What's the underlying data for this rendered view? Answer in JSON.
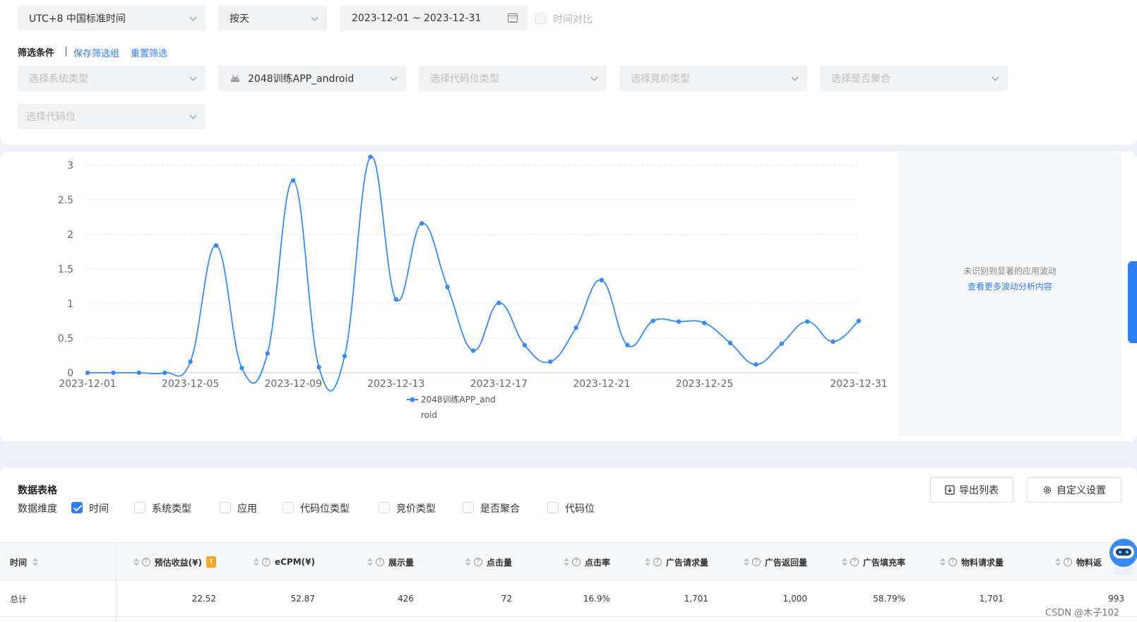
{
  "filters": {
    "timezone": "UTC+8 中国标准时间",
    "granularity": "按天",
    "date_range": "2023-12-01 ~ 2023-12-31",
    "compare_label": "时间对比",
    "conditions_label": "筛选条件",
    "save_group": "保存筛选组",
    "reset": "重置筛选",
    "system_type_placeholder": "选择系统类型",
    "app_selected": "2048训练APP_android",
    "slot_type_placeholder": "选择代码位类型",
    "bid_type_placeholder": "选择竞价类型",
    "aggregate_placeholder": "选择是否聚合",
    "slot_placeholder": "选择代码位"
  },
  "side_panel": {
    "message": "未识别到显著的应用波动",
    "link": "查看更多波动分析内容"
  },
  "chart_data": {
    "type": "line",
    "x": [
      "2023-12-01",
      "2023-12-02",
      "2023-12-03",
      "2023-12-04",
      "2023-12-05",
      "2023-12-06",
      "2023-12-07",
      "2023-12-08",
      "2023-12-09",
      "2023-12-10",
      "2023-12-11",
      "2023-12-12",
      "2023-12-13",
      "2023-12-14",
      "2023-12-15",
      "2023-12-16",
      "2023-12-17",
      "2023-12-18",
      "2023-12-19",
      "2023-12-20",
      "2023-12-21",
      "2023-12-22",
      "2023-12-23",
      "2023-12-24",
      "2023-12-25",
      "2023-12-26",
      "2023-12-27",
      "2023-12-28",
      "2023-12-29",
      "2023-12-30",
      "2023-12-31"
    ],
    "x_tick_labels": [
      "2023-12-01",
      "2023-12-05",
      "2023-12-09",
      "2023-12-13",
      "2023-12-17",
      "2023-12-21",
      "2023-12-25",
      "2023-12-31"
    ],
    "series": [
      {
        "name": "2048训练APP_android",
        "legend_lines": [
          "2048训练APP_and",
          "roid"
        ],
        "color": "#3a8af6",
        "values": [
          0,
          0,
          0,
          0,
          0.16,
          1.84,
          0.07,
          0.28,
          2.78,
          0.08,
          0.24,
          3.12,
          1.06,
          2.16,
          1.24,
          0.32,
          1.01,
          0.4,
          0.16,
          0.65,
          1.34,
          0.4,
          0.75,
          0.74,
          0.72,
          0.43,
          0.12,
          0.42,
          0.74,
          0.45,
          0.75
        ]
      }
    ],
    "y_ticks": [
      0,
      0.5,
      1,
      1.5,
      2,
      2.5,
      3
    ],
    "y_tick_labels": [
      "0",
      "0.5",
      "1",
      "1.5",
      "2",
      "2.5",
      "3"
    ],
    "grid": true,
    "legend_position": "bottom"
  },
  "table": {
    "title": "数据表格",
    "export_button": "导出列表",
    "custom_button": "自定义设置",
    "dimension_label": "数据维度",
    "dimensions": [
      {
        "label": "时间",
        "checked": true
      },
      {
        "label": "系统类型",
        "checked": false
      },
      {
        "label": "应用",
        "checked": false
      },
      {
        "label": "代码位类型",
        "checked": false
      },
      {
        "label": "竞价类型",
        "checked": false
      },
      {
        "label": "是否聚合",
        "checked": false
      },
      {
        "label": "代码位",
        "checked": false
      }
    ],
    "first_column": "时间",
    "columns": [
      "预估收益(¥)",
      "eCPM(¥)",
      "展示量",
      "点击量",
      "点击率",
      "广告请求量",
      "广告返回量",
      "广告填充率",
      "物料请求量",
      "物料返"
    ],
    "warn_badge": "!",
    "total_label": "总计",
    "total_row": [
      "22.52",
      "52.87",
      "426",
      "72",
      "16.9%",
      "1,701",
      "1,000",
      "58.79%",
      "1,701",
      "993"
    ]
  },
  "watermark": "CSDN @木子102"
}
